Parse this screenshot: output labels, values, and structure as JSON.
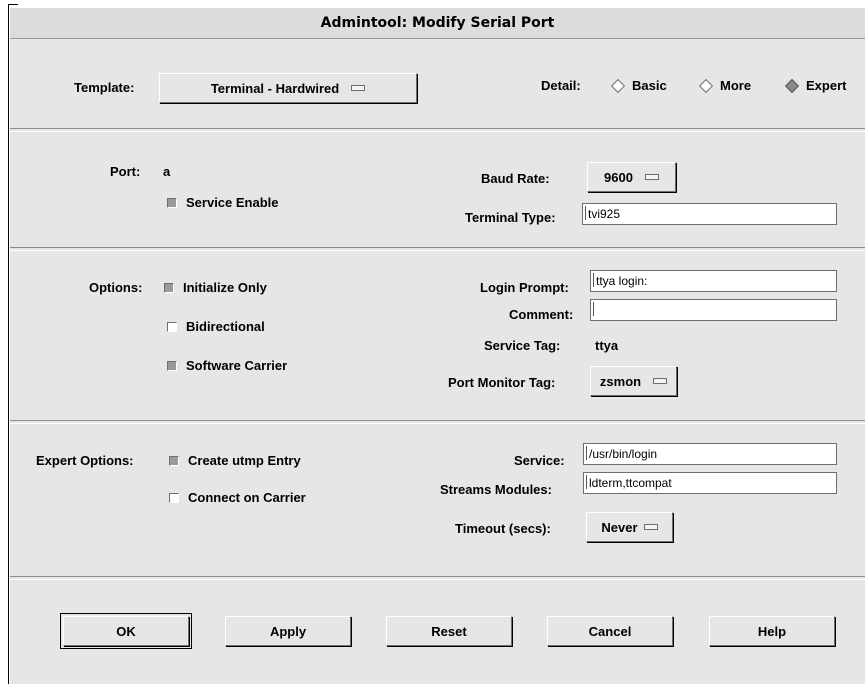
{
  "window": {
    "title": "Admintool: Modify Serial Port"
  },
  "header": {
    "template_label": "Template:",
    "template_value": "Terminal - Hardwired",
    "detail_label": "Detail:",
    "detail_options": [
      "Basic",
      "More",
      "Expert"
    ],
    "detail_selected": "Expert"
  },
  "port_section": {
    "port_label": "Port:",
    "port_value": "a",
    "service_enable_label": "Service Enable",
    "service_enable_checked": true,
    "baud_rate_label": "Baud Rate:",
    "baud_rate_value": "9600",
    "terminal_type_label": "Terminal Type:",
    "terminal_type_value": "tvi925"
  },
  "options_section": {
    "options_label": "Options:",
    "initialize_only_label": "Initialize Only",
    "initialize_only_checked": true,
    "bidirectional_label": "Bidirectional",
    "bidirectional_checked": false,
    "software_carrier_label": "Software Carrier",
    "software_carrier_checked": true,
    "login_prompt_label": "Login Prompt:",
    "login_prompt_value": "ttya login:",
    "comment_label": "Comment:",
    "comment_value": "",
    "service_tag_label": "Service Tag:",
    "service_tag_value": "ttya",
    "port_monitor_tag_label": "Port Monitor Tag:",
    "port_monitor_tag_value": "zsmon"
  },
  "expert_section": {
    "expert_options_label": "Expert Options:",
    "create_utmp_label": "Create utmp Entry",
    "create_utmp_checked": true,
    "connect_on_carrier_label": "Connect on Carrier",
    "connect_on_carrier_checked": false,
    "service_label": "Service:",
    "service_value": "/usr/bin/login",
    "streams_modules_label": "Streams Modules:",
    "streams_modules_value": "ldterm,ttcompat",
    "timeout_label": "Timeout (secs):",
    "timeout_value": "Never"
  },
  "buttons": {
    "ok": "OK",
    "apply": "Apply",
    "reset": "Reset",
    "cancel": "Cancel",
    "help": "Help"
  }
}
